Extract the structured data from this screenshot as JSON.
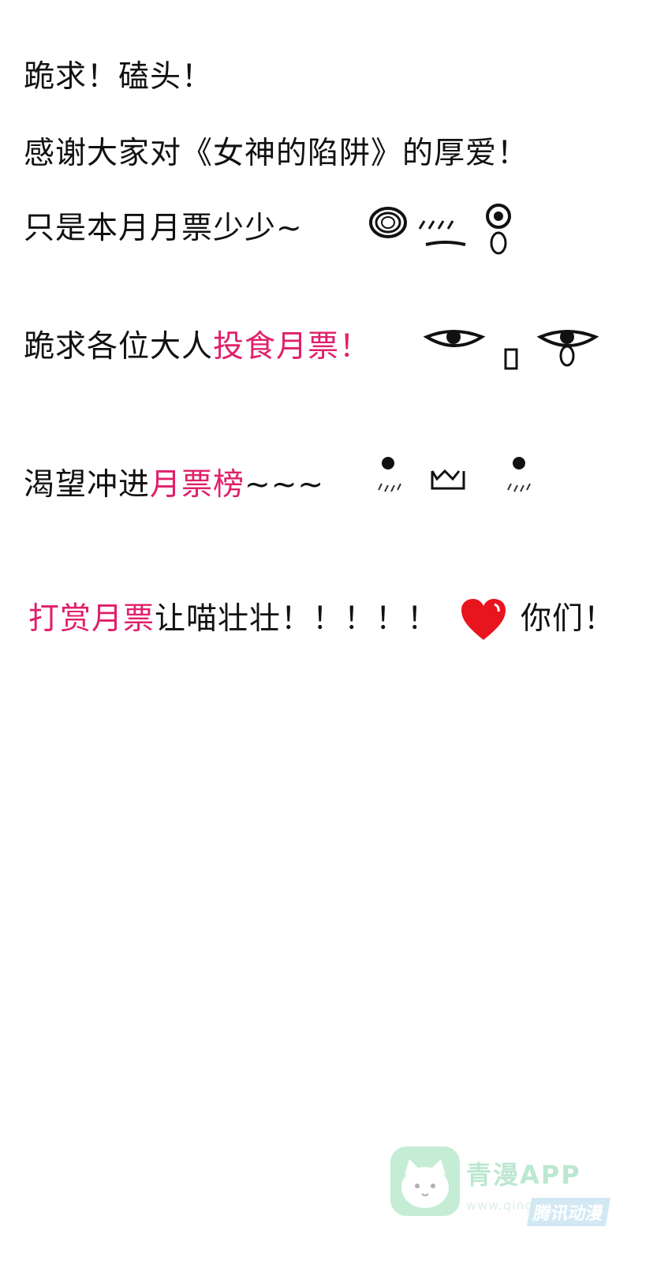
{
  "lines": {
    "l1": "跪求！磕头！",
    "l2": "感谢大家对《女神的陷阱》的厚爱！",
    "l3": "只是本月月票少少~",
    "l4_a": "跪求各位大人",
    "l4_b": "投食月票！",
    "l5_a": "渴望冲进",
    "l5_b": "月票榜",
    "l5_c": "~~~",
    "l6_a": "打赏月票",
    "l6_b": "让喵壮壮！！！！！",
    "l6_c": "你们！"
  },
  "watermark": {
    "title": "青漫APP",
    "url": "www.qing...",
    "badge": "腾讯动漫"
  },
  "colors": {
    "accent": "#e0206a",
    "heart": "#e8141e",
    "watermark": "#6ccb98"
  },
  "icons": [
    "crying-face-emoticon",
    "teary-face-emoticon",
    "blushing-face-emoticon",
    "heart-icon",
    "cat-logo-icon"
  ]
}
